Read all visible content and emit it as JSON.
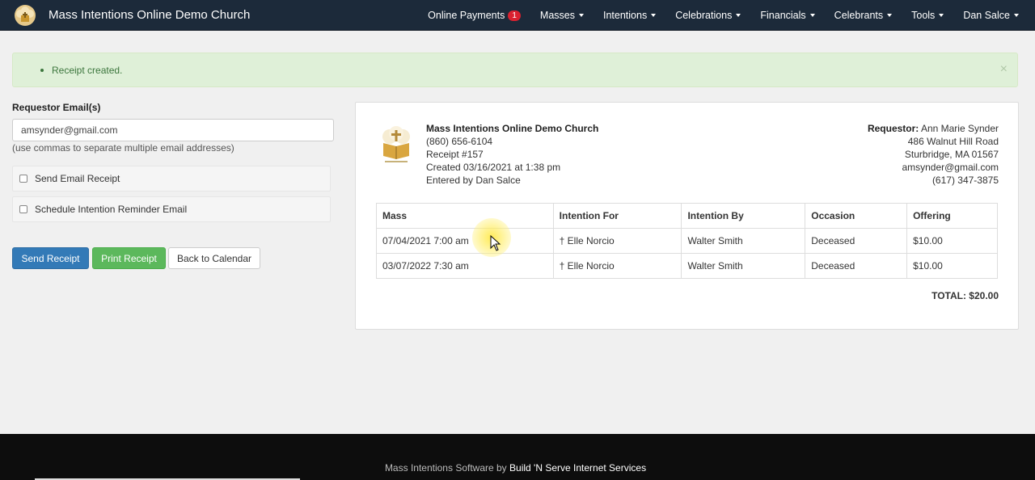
{
  "navbar": {
    "title": "Mass Intentions Online Demo Church",
    "items": [
      {
        "label": "Online Payments",
        "badge": "1"
      },
      {
        "label": "Masses"
      },
      {
        "label": "Intentions"
      },
      {
        "label": "Celebrations"
      },
      {
        "label": "Financials"
      },
      {
        "label": "Celebrants"
      },
      {
        "label": "Tools"
      },
      {
        "label": "Dan Salce"
      }
    ]
  },
  "alert": {
    "message": "Receipt created.",
    "close": "×"
  },
  "form": {
    "label": "Requestor Email(s)",
    "email_value": "amsynder@gmail.com",
    "help": "(use commas to separate multiple email addresses)",
    "send_email_receipt": "Send Email Receipt",
    "schedule_reminder": "Schedule Intention Reminder Email",
    "buttons": {
      "send": "Send Receipt",
      "print": "Print Receipt",
      "back": "Back to Calendar"
    }
  },
  "receipt": {
    "church_name": "Mass Intentions Online Demo Church",
    "phone": "(860) 656-6104",
    "number": "Receipt #157",
    "created": "Created 03/16/2021 at 1:38 pm",
    "entered_by": "Entered by Dan Salce",
    "requestor_label": "Requestor:",
    "requestor_name": "Ann Marie Synder",
    "address1": "486 Walnut Hill Road",
    "address2": "Sturbridge, MA 01567",
    "email": "amsynder@gmail.com",
    "req_phone": "(617) 347-3875",
    "columns": [
      "Mass",
      "Intention For",
      "Intention By",
      "Occasion",
      "Offering"
    ],
    "rows": [
      [
        "07/04/2021 7:00 am",
        "† Elle Norcio",
        "Walter Smith",
        "Deceased",
        "$10.00"
      ],
      [
        "03/07/2022 7:30 am",
        "† Elle Norcio",
        "Walter Smith",
        "Deceased",
        "$10.00"
      ]
    ],
    "total": "TOTAL: $20.00"
  },
  "footer": {
    "prefix": "Mass Intentions Software by",
    "company": "Build 'N Serve Internet Services"
  }
}
